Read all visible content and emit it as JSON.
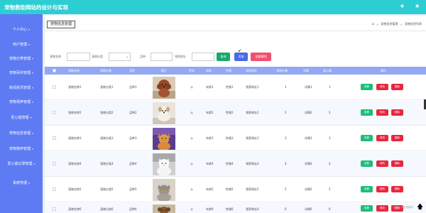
{
  "app": {
    "title": "宠物救助网站的设计与实现"
  },
  "topbar": {
    "icons": [
      "settings-icon",
      "close-icon"
    ]
  },
  "sidebar": {
    "items": [
      {
        "label": "个人中心"
      },
      {
        "label": "用户管理"
      },
      {
        "label": "宠物分类管理"
      },
      {
        "label": "宠物百科管理"
      },
      {
        "label": "新闻资讯管理"
      },
      {
        "label": "宠物领养管理"
      },
      {
        "label": "爱心值管理"
      },
      {
        "label": "宠物信息管理"
      },
      {
        "label": "宠物救养管理"
      },
      {
        "label": "爱心值记录管理"
      },
      {
        "label": "系统管理"
      }
    ]
  },
  "tab": {
    "label": "宠物信息管理"
  },
  "breadcrumb": {
    "home_icon": "home-icon",
    "item1": "宠物信息管理",
    "item2": "宠物信息列表"
  },
  "filters": {
    "name_label": "宠物名称",
    "category_label": "宠物分类",
    "breed_label": "品种",
    "address_label": "领养地址",
    "search_label": "查询",
    "add_label": "添加",
    "batch_delete_label": "批量删除"
  },
  "table": {
    "headers": [
      "宠物名称",
      "宠物分类",
      "品种",
      "图片",
      "性别",
      "年龄",
      "性格",
      "领养地址",
      "领养价格",
      "详情",
      "爱心值",
      "操作"
    ],
    "view_label": "查看",
    "edit_label": "修改",
    "delete_label": "删除",
    "rows": [
      {
        "name": "宠物名称1",
        "category": "宠物分类1",
        "breed": "品种1",
        "image": "dog-red-poodle",
        "sex": "公",
        "age": "年龄1",
        "personality": "性格1",
        "address": "领养地址1",
        "price": "1",
        "detail": "详情1",
        "love": "1"
      },
      {
        "name": "宠物名称2",
        "category": "宠物分类2",
        "breed": "品种2",
        "image": "dog-small-white",
        "sex": "公",
        "age": "年龄2",
        "personality": "性格2",
        "address": "领养地址2",
        "price": "2",
        "detail": "详情2",
        "love": "2"
      },
      {
        "name": "宠物名称3",
        "category": "宠物分类3",
        "breed": "品种3",
        "image": "cat-orange-purple-bg",
        "sex": "公",
        "age": "年龄3",
        "personality": "性格3",
        "address": "领养地址3",
        "price": "3",
        "detail": "详情3",
        "love": "3"
      },
      {
        "name": "宠物名称4",
        "category": "宠物分类4",
        "breed": "品种4",
        "image": "cat-white-fluffy",
        "sex": "公",
        "age": "年龄4",
        "personality": "性格4",
        "address": "领养地址4",
        "price": "4",
        "detail": "详情4",
        "love": "4"
      },
      {
        "name": "宠物名称5",
        "category": "宠物分类5",
        "breed": "品种5",
        "image": "cat-grey-tabby",
        "sex": "公",
        "age": "年龄5",
        "personality": "性格5",
        "address": "领养地址5",
        "price": "5",
        "detail": "详情5",
        "love": "5"
      },
      {
        "name": "宠物名称6",
        "category": "宠物分类6",
        "breed": "品种6",
        "image": "dog-brown-pup",
        "sex": "公",
        "age": "年龄6",
        "personality": "性格6",
        "address": "领养地址6",
        "price": "6",
        "detail": "详情6",
        "love": "6"
      }
    ]
  },
  "watermark": "CSDN @宠物救助",
  "colors": {
    "topbar": "#2ccdd3",
    "sidebar": "#5e7bf3",
    "header_row": "#93a8f2",
    "search_btn": "#18a86b",
    "add_btn": "#4a68e8",
    "delete_btn": "#f0506e",
    "view_btn": "#1dbd7a",
    "edit_btn": "#e8273f"
  }
}
